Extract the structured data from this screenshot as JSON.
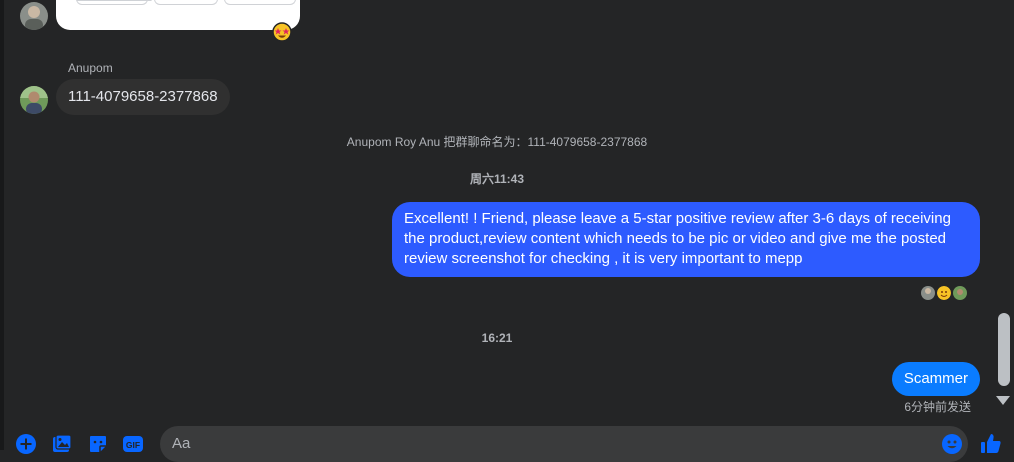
{
  "conversation": {
    "incoming": {
      "sender_name": "Anupom",
      "message": "111-4079658-2377868"
    },
    "system_notice": "Anupom Roy Anu 把群聊命名为：111-4079658-2377868",
    "timestamps": [
      "周六11:43",
      "16:21"
    ],
    "outgoing": [
      {
        "text": "Excellent! ! Friend, please leave a 5-star positive review after 3-6 days of receiving the product,review content which needs to be pic or video and give me the posted review screenshot for checking , it is very important to mepp"
      },
      {
        "text": "Scammer"
      }
    ],
    "sent_status": "6分钟前发送",
    "reaction_icon": "star-struck-emoji-icon"
  },
  "composer": {
    "placeholder": "Aa",
    "actions": [
      "add-icon",
      "image-icon",
      "sticker-icon",
      "gif-icon"
    ],
    "gif_label": "GIF"
  },
  "colors": {
    "background": "#242526",
    "outgoing_bubble": "#2D5BFF",
    "outgoing_bubble_alt": "#0a7cff",
    "incoming_bubble": "#303030",
    "accent": "#0866ff"
  }
}
